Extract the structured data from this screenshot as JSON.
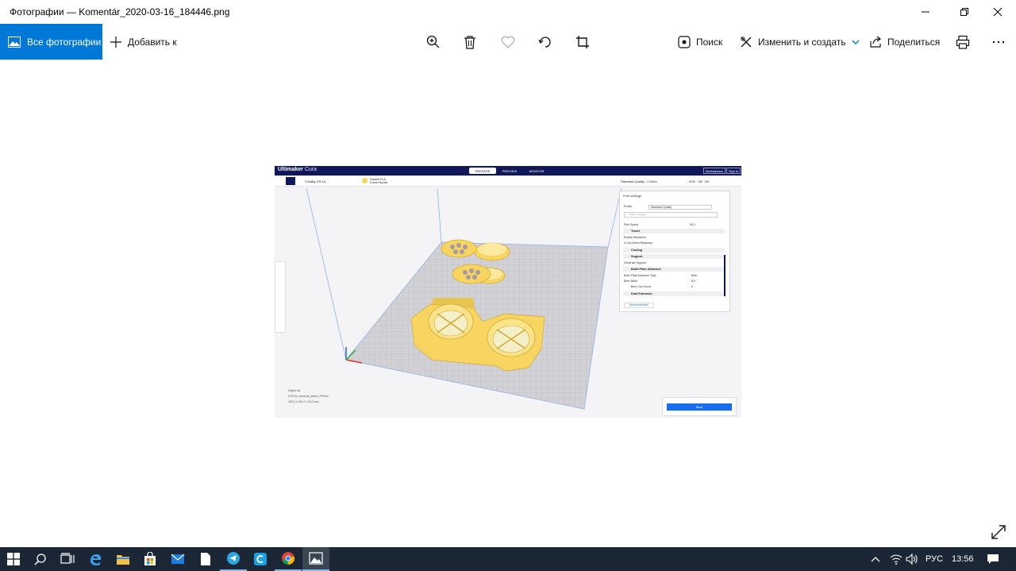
{
  "window": {
    "title": "Фотографии — Komentár_2020-03-16_184446.png",
    "controls": [
      "minimize-icon",
      "maximize-icon",
      "close-icon"
    ]
  },
  "toolbar": {
    "all_photos": "Все фотографии",
    "add_to": "Добавить к",
    "search": "Поиск",
    "edit_create": "Изменить и создать",
    "share": "Поделиться",
    "icons": [
      "zoom-icon",
      "delete-icon",
      "favorite-heart-icon",
      "rotate-icon",
      "crop-icon",
      "print-icon",
      "more-icon"
    ],
    "accent": "#0078d7"
  },
  "photo": {
    "brand": "Ultimaker",
    "brand_suffix": "Cura",
    "stages": [
      "PREPARE",
      "PREVIEW",
      "MONITOR"
    ],
    "active_stage": "PREPARE",
    "marketplace": "Marketplace",
    "signin": "Sign in",
    "printer": "Creality CR-10",
    "nozzle_line1": "Generic PLA",
    "nozzle_line2": "0.4mm Nozzle",
    "quality": "Standard Quality - 0.2mm",
    "ext_values": [
      "20%",
      "Off",
      "On"
    ],
    "panel": {
      "title": "Print settings",
      "profile_label": "Profile",
      "profile_value": "Standard Quality",
      "search_placeholder": "Search settings",
      "print_speed": "Print Speed",
      "print_speed_value": "50.0",
      "travel": "Travel",
      "enable_retraction": "Enable Retraction",
      "z_hop": "Z Hop When Retracted",
      "cooling": "Cooling",
      "support": "Support",
      "generate_support": "Generate Support",
      "adhesion": "Build Plate Adhesion",
      "adhesion_type": "Build Plate Adhesion Type",
      "adhesion_type_value": "Brim",
      "brim_width": "Brim Width",
      "brim_width_value": "8.0",
      "brim_line_count": "Brim Line Count",
      "brim_line_count_value": "0",
      "dual_extrusion": "Dual Extrusion",
      "recommended": "Recommended"
    },
    "slice": "Slice",
    "object_list": "Object list",
    "object_name": "CCP16_mask.stl_yellow_FFbrim",
    "object_size": "185.3 x 163.2 x 18.0 mm",
    "model_color": "#f7d560",
    "accent": "#196ef0",
    "header_color": "#10185a"
  },
  "tray": {
    "lang": "РУС",
    "time": "13:56"
  },
  "taskbar": {
    "background": "#1b2734",
    "icons": [
      "start-icon",
      "search-icon",
      "task-view-icon",
      "edge-icon",
      "file-explorer-icon",
      "store-icon",
      "mail-icon",
      "file-icon",
      "telegram-icon",
      "ccleaner-icon",
      "chrome-icon",
      "photos-icon"
    ]
  }
}
